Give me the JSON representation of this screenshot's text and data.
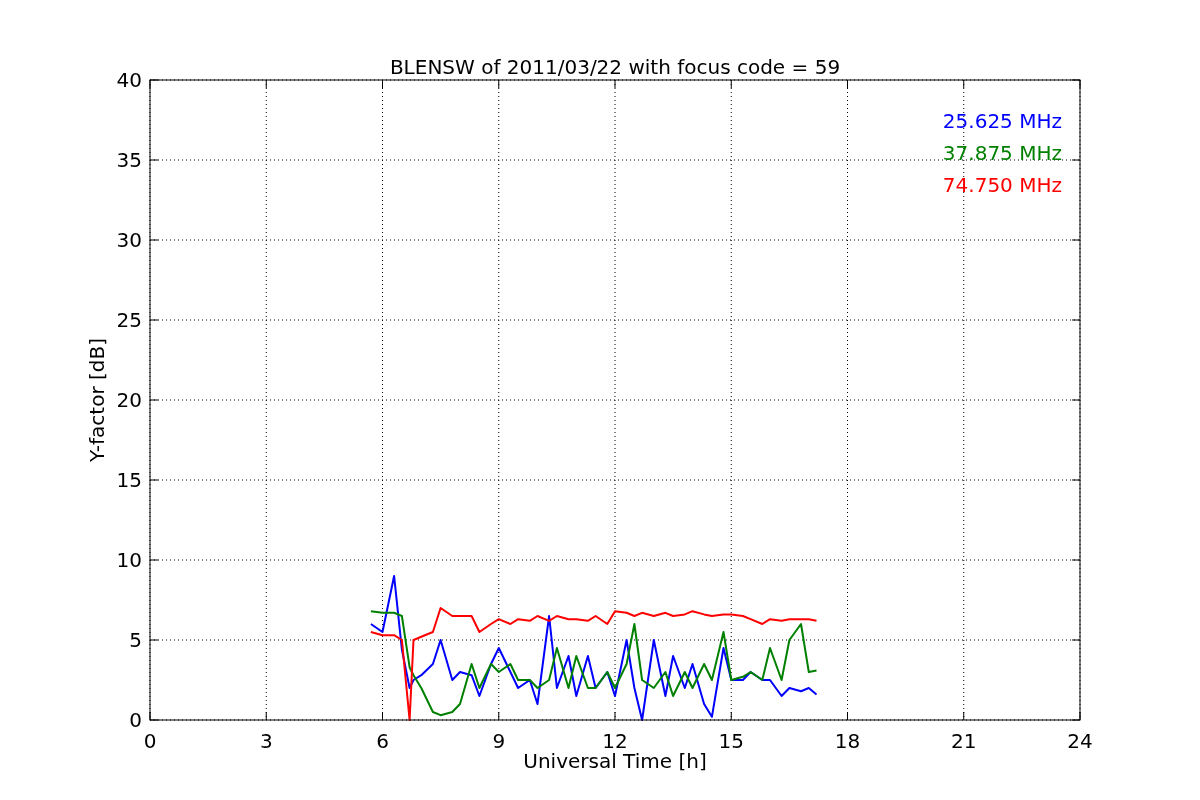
{
  "chart_data": {
    "type": "line",
    "title": "BLENSW of 2011/03/22 with focus code = 59",
    "xlabel": "Universal Time [h]",
    "ylabel": "Y-factor [dB]",
    "x": [
      5.7,
      6.0,
      6.3,
      6.5,
      6.7,
      6.8,
      7.0,
      7.3,
      7.5,
      7.8,
      8.0,
      8.3,
      8.5,
      8.8,
      9.0,
      9.3,
      9.5,
      9.8,
      10.0,
      10.3,
      10.5,
      10.8,
      11.0,
      11.3,
      11.5,
      11.8,
      12.0,
      12.3,
      12.5,
      12.7,
      13.0,
      13.3,
      13.5,
      13.8,
      14.0,
      14.3,
      14.5,
      14.8,
      15.0,
      15.3,
      15.5,
      15.8,
      16.0,
      16.3,
      16.5,
      16.8,
      17.0,
      17.2
    ],
    "series": [
      {
        "name": "25.625 MHz",
        "color": "#0000ff",
        "values": [
          6,
          5.5,
          9,
          4.4,
          2,
          2.5,
          2.8,
          3.5,
          5,
          2.5,
          3,
          2.8,
          1.5,
          3.5,
          4.5,
          3,
          2,
          2.5,
          1,
          6.5,
          2,
          4,
          1.5,
          4,
          2,
          3,
          1.5,
          5,
          2,
          0,
          5,
          1.5,
          4,
          2,
          3.5,
          1,
          0.2,
          4.5,
          2.5,
          2.5,
          3,
          2.5,
          2.5,
          1.5,
          2,
          1.8,
          2,
          1.6
        ]
      },
      {
        "name": "37.875 MHz",
        "color": "#008000",
        "values": [
          6.8,
          6.7,
          6.7,
          6.5,
          3.3,
          2.8,
          2,
          0.5,
          0.3,
          0.5,
          1,
          3.5,
          2,
          3.5,
          3,
          3.5,
          2.5,
          2.5,
          2,
          2.5,
          4.5,
          2,
          4,
          2,
          2,
          3,
          2,
          3.5,
          6,
          2.5,
          2,
          3,
          1.5,
          3,
          2,
          3.5,
          2.5,
          5.5,
          2.5,
          2.7,
          3,
          2.5,
          4.5,
          2.5,
          5,
          6,
          3,
          3.1
        ]
      },
      {
        "name": "74.750 MHz",
        "color": "#ff0000",
        "values": [
          5.5,
          5.3,
          5.3,
          5,
          0,
          5,
          5.2,
          5.5,
          7,
          6.5,
          6.5,
          6.5,
          5.5,
          6,
          6.3,
          6,
          6.3,
          6.2,
          6.5,
          6.2,
          6.5,
          6.3,
          6.3,
          6.2,
          6.5,
          6,
          6.8,
          6.7,
          6.5,
          6.7,
          6.5,
          6.7,
          6.5,
          6.6,
          6.8,
          6.6,
          6.5,
          6.6,
          6.6,
          6.5,
          6.3,
          6,
          6.3,
          6.2,
          6.3,
          6.3,
          6.3,
          6.2
        ]
      }
    ],
    "grid": true,
    "xlim": [
      0,
      24
    ],
    "ylim": [
      0,
      40
    ],
    "xticks": [
      0,
      3,
      6,
      9,
      12,
      15,
      18,
      21,
      24
    ],
    "yticks": [
      0,
      5,
      10,
      15,
      20,
      25,
      30,
      35,
      40
    ]
  }
}
